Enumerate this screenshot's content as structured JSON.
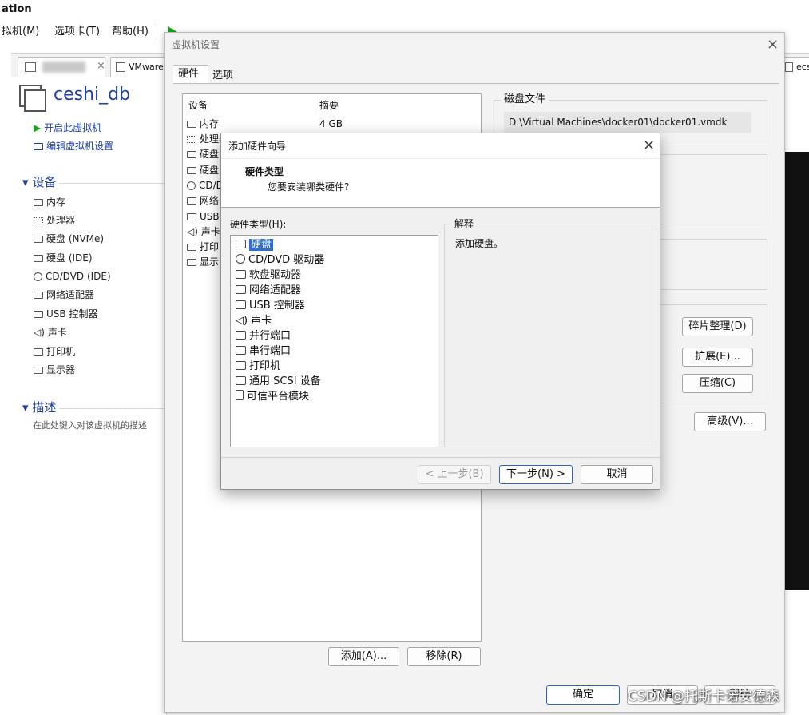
{
  "app": {
    "title_fragment": "ation"
  },
  "menubar": {
    "items": [
      "拟机(M)",
      "选项卡(T)",
      "帮助(H)"
    ]
  },
  "tabs": {
    "tab2_label": "VMware",
    "right_tab_label": "ecs"
  },
  "vm": {
    "name": "ceshi_db",
    "actions": {
      "start": "开启此虚拟机",
      "edit": "编辑虚拟机设置"
    },
    "devices_header": "设备",
    "devices": [
      "内存",
      "处理器",
      "硬盘 (NVMe)",
      "硬盘 (IDE)",
      "CD/DVD (IDE)",
      "网络适配器",
      "USB 控制器",
      "声卡",
      "打印机",
      "显示器"
    ],
    "description_header": "描述",
    "description_placeholder": "在此处键入对该虚拟机的描述"
  },
  "settings_dialog": {
    "title": "虚拟机设置",
    "tabs": [
      "硬件",
      "选项"
    ],
    "col_device": "设备",
    "col_summary": "摘要",
    "rows": [
      {
        "device": "内存",
        "summary": "4 GB"
      },
      {
        "device": "处理器",
        "summary": ""
      },
      {
        "device": "硬盘",
        "summary": ""
      },
      {
        "device": "硬盘",
        "summary": ""
      },
      {
        "device": "CD/D",
        "summary": ""
      },
      {
        "device": "网络",
        "summary": ""
      },
      {
        "device": "USB",
        "summary": ""
      },
      {
        "device": "声卡",
        "summary": ""
      },
      {
        "device": "打印",
        "summary": ""
      },
      {
        "device": "显示",
        "summary": ""
      }
    ],
    "disk_file_label": "磁盘文件",
    "disk_file_path": "D:\\Virtual Machines\\docker01\\docker01.vmdk",
    "buttons": {
      "defrag": "碎片整理(D)",
      "expand": "扩展(E)...",
      "compact": "压缩(C)",
      "advanced": "高级(V)...",
      "add": "添加(A)...",
      "remove": "移除(R)",
      "ok": "确定",
      "cancel": "取消",
      "help": "帮助"
    }
  },
  "wizard": {
    "title": "添加硬件向导",
    "heading": "硬件类型",
    "question": "您要安装哪类硬件?",
    "list_label": "硬件类型(H):",
    "items": [
      "硬盘",
      "CD/DVD 驱动器",
      "软盘驱动器",
      "网络适配器",
      "USB 控制器",
      "声卡",
      "并行端口",
      "串行端口",
      "打印机",
      "通用 SCSI 设备",
      "可信平台模块"
    ],
    "selected_index": 0,
    "explanation_label": "解释",
    "explanation_text": "添加硬盘。",
    "buttons": {
      "back": "< 上一步(B)",
      "next": "下一步(N) >",
      "cancel": "取消"
    }
  },
  "watermark": "CSDN @托斯卡诺安德森",
  "colors": {
    "accent": "#2b6fd6",
    "start_green": "#1aa31a",
    "link_blue": "#1c3fa8"
  }
}
